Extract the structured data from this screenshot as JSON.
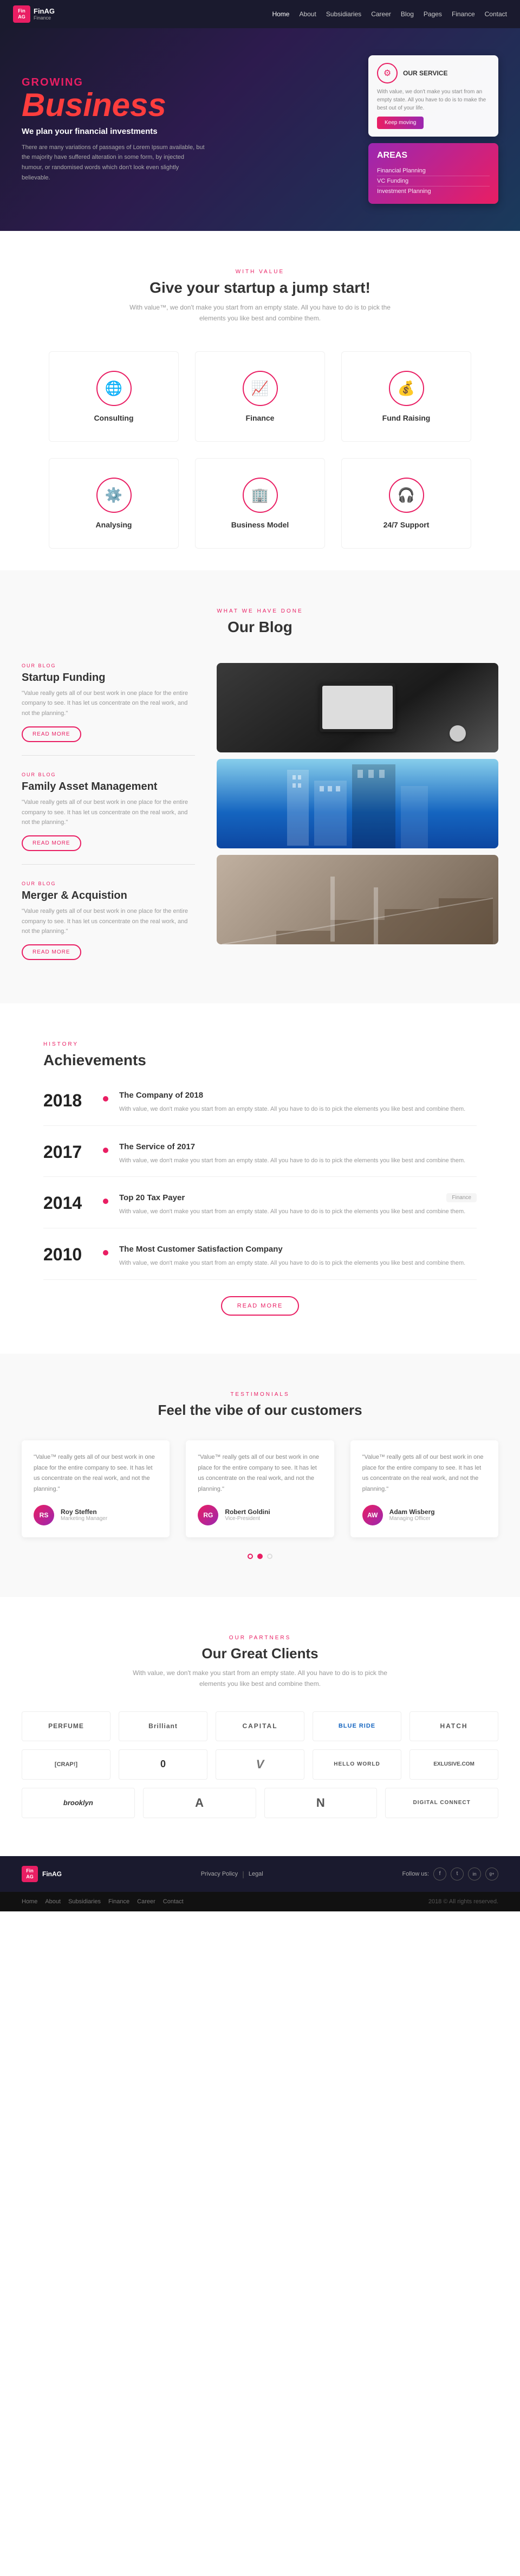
{
  "header": {
    "logo_text": "FinAG",
    "logo_sub": "Finance",
    "nav": [
      "Home",
      "About",
      "Subsidiaries",
      "Career",
      "Blog",
      "Pages",
      "Finance",
      "Contact"
    ]
  },
  "hero": {
    "growing": "GROWING",
    "business": "Business",
    "subtitle": "We plan your financial investments",
    "text": "There are many variations of passages of Lorem Ipsum available, but the majority have suffered alteration in some form, by injected humour, or randomised words which don't look even slightly believable.",
    "service_card": {
      "title": "OUR SERVICE",
      "desc": "With value, we don't make you start from an empty state. All you have to do is to make the best out of your life.",
      "btn": "Keep moving"
    },
    "areas_card": {
      "label": "AREAS",
      "items": [
        "Financial Planning",
        "VC Funding",
        "Investment Planning"
      ]
    }
  },
  "startup_section": {
    "label": "WITH VALUE",
    "title": "Give your startup a jump start!",
    "desc": "With value™, we don't make you start from an empty state. All you have to do is to pick the elements you like best and combine them."
  },
  "services": [
    {
      "name": "Consulting",
      "icon": "🌐"
    },
    {
      "name": "Finance",
      "icon": "📊"
    },
    {
      "name": "Fund Raising",
      "icon": "💰"
    },
    {
      "name": "Analysing",
      "icon": "⚙️"
    },
    {
      "name": "Business Model",
      "icon": "🏢"
    },
    {
      "name": "24/7 Support",
      "icon": "👜"
    }
  ],
  "blog": {
    "label": "WHAT WE HAVE DONE",
    "title": "Our Blog",
    "posts": [
      {
        "date_label": "OUR BLOG",
        "title": "Startup Funding",
        "excerpt": "\"Value really gets all of our best work in one place for the entire company to see. It has let us concentrate on the real work, and not the planning.\"",
        "btn": "READ MORE"
      },
      {
        "date_label": "OUR BLOG",
        "title": "Family Asset Management",
        "excerpt": "\"Value really gets all of our best work in one place for the entire company to see. It has let us concentrate on the real work, and not the planning.\"",
        "btn": "READ MORE"
      },
      {
        "date_label": "OUR BLOG",
        "title": "Merger & Acquistion",
        "excerpt": "\"Value really gets all of our best work in one place for the entire company to see. It has let us concentrate on the real work, and not the planning.\"",
        "btn": "READ MORE"
      }
    ]
  },
  "achievements": {
    "label": "HISTORY",
    "title": "Achievements",
    "items": [
      {
        "year": "2018",
        "award": "The Company of 2018",
        "desc": "With value, we don't make you start from an empty state. All you have to do is to pick the elements you like best and combine them."
      },
      {
        "year": "2017",
        "award": "The Service of 2017",
        "desc": "With value, we don't make you start from an empty state. All you have to do is to pick the elements you like best and combine them."
      },
      {
        "year": "2014",
        "award": "Top 20 Tax Payer",
        "badge": "Finance",
        "desc": "With value, we don't make you start from an empty state. All you have to do is to pick the elements you like best and combine them."
      },
      {
        "year": "2010",
        "award": "The Most Customer Satisfaction Company",
        "desc": "With value, we don't make you start from an empty state. All you have to do is to pick the elements you like best and combine them."
      }
    ],
    "btn": "READ MORE"
  },
  "testimonials": {
    "label": "TESTIMONIALS",
    "title": "Feel the vibe of our customers",
    "items": [
      {
        "text": "\"Value™ really gets all of our best work in one place for the entire company to see. It has let us concentrate on the real work, and not the planning.\"",
        "author": "Roy Steffen",
        "role": "Marketing Manager",
        "initials": "RS"
      },
      {
        "text": "\"Value™ really gets all of our best work in one place for the entire company to see. It has let us concentrate on the real work, and not the planning.\"",
        "author": "Robert Goldini",
        "role": "Vice-President",
        "initials": "RG"
      },
      {
        "text": "\"Value™ really gets all of our best work in one place for the entire company to see. It has let us concentrate on the real work, and not the planning.\"",
        "author": "Adam Wisberg",
        "role": "Managing Officer",
        "initials": "AW"
      }
    ]
  },
  "clients": {
    "label": "OUR PARTNERS",
    "title": "Our Great Clients",
    "desc": "With value, we don't make you start from an empty state. All you have to do is to pick the elements you like best and combine them.",
    "logos_row1": [
      "PERFUME",
      "Brilliant",
      "CAPITAL",
      "BLUE RIDE",
      "HATCH"
    ],
    "logos_row2": [
      "[CRAP!]",
      "0",
      "V",
      "HELLO WORLD",
      "EXLUSIVE.COM"
    ],
    "logos_row3": [
      "brooklyn",
      "A",
      "N",
      "DIGITAL CONNECT"
    ]
  },
  "footer": {
    "logo": "FinAG",
    "privacy": "Privacy Policy",
    "legal": "Legal",
    "nav": [
      "Home",
      "About",
      "Subsidiaries",
      "Finance",
      "Career",
      "Contact"
    ],
    "copy": "2018 © All rights reserved.",
    "social": [
      "f",
      "t",
      "in",
      "g+"
    ]
  }
}
